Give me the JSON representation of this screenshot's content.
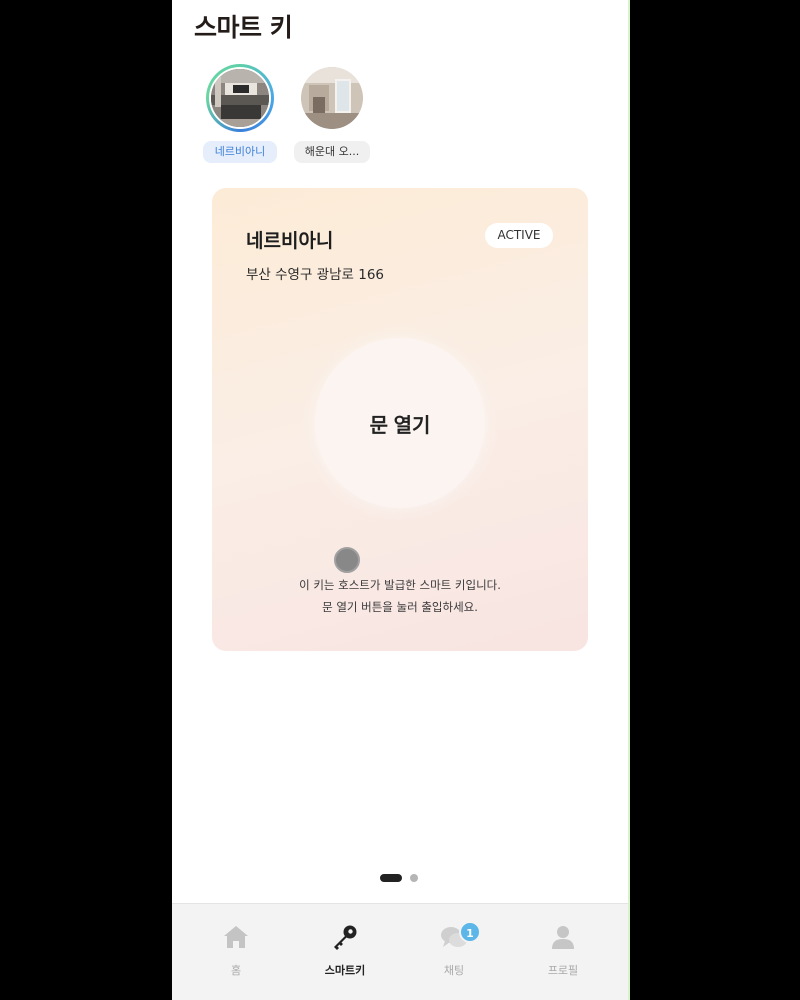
{
  "header": {
    "title": "스마트 키"
  },
  "properties": [
    {
      "label": "네르비아니",
      "selected": true
    },
    {
      "label": "해운대 오...",
      "selected": false
    }
  ],
  "card": {
    "name": "네르비아니",
    "status": "ACTIVE",
    "address": "부산 수영구 광남로 166",
    "open_label": "문 열기",
    "hint_line1": "이 키는 호스트가 발급한 스마트 키입니다.",
    "hint_line2": "문 열기 버튼을 눌러 출입하세요.",
    "gradient_colors": [
      "#fcebd6",
      "#f8e4e1"
    ]
  },
  "pager": {
    "pages": 2,
    "current": 1
  },
  "tabs": [
    {
      "label": "홈",
      "icon": "home-icon",
      "active": false
    },
    {
      "label": "스마트키",
      "icon": "key-icon",
      "active": true
    },
    {
      "label": "채팅",
      "icon": "chat-icon",
      "active": false,
      "badge": "1"
    },
    {
      "label": "프로필",
      "icon": "profile-icon",
      "active": false
    }
  ],
  "colors": {
    "accent": "#3c7fd8",
    "badge": "#5cb6e8",
    "tab_inactive": "#a9a9a9",
    "tab_active": "#222222"
  }
}
